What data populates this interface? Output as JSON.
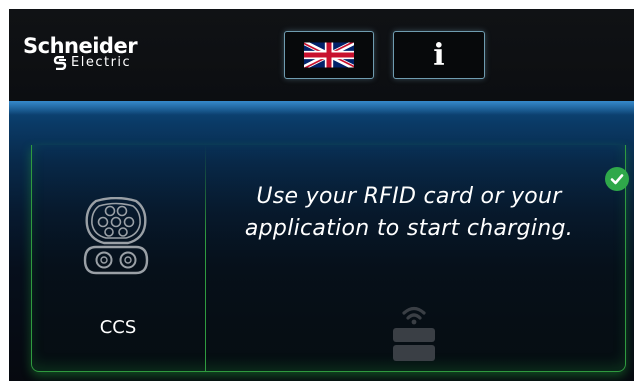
{
  "header": {
    "brand_line1": "Schneider",
    "brand_line2": "Electric",
    "language_button": {
      "icon": "uk-flag-icon"
    },
    "info_button": {
      "label": "i"
    }
  },
  "connector": {
    "name": "CCS",
    "icon": "ccs-connector-icon"
  },
  "status": {
    "message": "Use your RFID card or your application to start charging.",
    "indicator": "check-icon",
    "indicator_color": "#2fa84a"
  },
  "rfid": {
    "icon": "rfid-reader-icon"
  },
  "colors": {
    "accent_green": "#2f9a3f",
    "header_bg": "#101215",
    "top_glow_blue": "#0e4a7e"
  }
}
